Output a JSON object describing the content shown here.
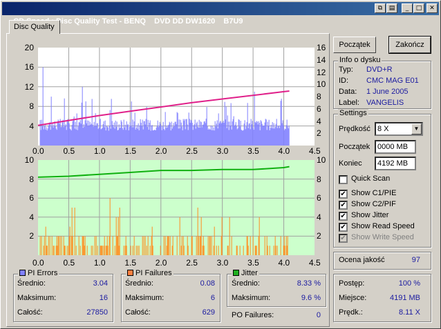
{
  "window": {
    "title": "CD Speed : Disc Quality Test - BENQ    DVD DD DW1620    B7U9",
    "buttons": {
      "restore": "⧉",
      "minimize": "_",
      "maximize": "□",
      "close": "✕"
    }
  },
  "tab": {
    "label": "Disc Quality"
  },
  "charts": {
    "top": {
      "y_left_ticks": [
        "20",
        "16",
        "12",
        "8",
        "4"
      ],
      "y_right_ticks": [
        "16",
        "14",
        "12",
        "10",
        "8",
        "6",
        "4",
        "2"
      ],
      "x_ticks": [
        "0.0",
        "0.5",
        "1.0",
        "1.5",
        "2.0",
        "2.5",
        "3.0",
        "3.5",
        "4.0",
        "4.5"
      ]
    },
    "bottom": {
      "y_left_ticks": [
        "10",
        "8",
        "6",
        "4",
        "2"
      ],
      "y_right_ticks": [
        "10",
        "8",
        "6",
        "4",
        "2"
      ],
      "x_ticks": [
        "0.0",
        "0.5",
        "1.0",
        "1.5",
        "2.0",
        "2.5",
        "3.0",
        "3.5",
        "4.0",
        "4.5"
      ]
    }
  },
  "chart_data": [
    {
      "type": "bar",
      "xlim": [
        0,
        4.5
      ],
      "ylim": [
        0,
        20
      ],
      "y2lim": [
        0,
        16
      ],
      "grid": true,
      "series": [
        {
          "name": "PI Errors",
          "color": "#8080ff",
          "approx_baseline": 3,
          "max": 16
        },
        {
          "name": "Read Speed",
          "color": "#e0208a",
          "type": "line",
          "x": [
            0.0,
            0.5,
            1.0,
            1.5,
            2.0,
            2.5,
            3.0,
            3.5,
            4.0,
            4.09
          ],
          "values": [
            3.3,
            4.1,
            4.9,
            5.6,
            6.3,
            7.0,
            7.6,
            8.2,
            8.8,
            8.9
          ]
        }
      ]
    },
    {
      "type": "bar",
      "xlim": [
        0,
        4.5
      ],
      "ylim": [
        0,
        10
      ],
      "grid": true,
      "series": [
        {
          "name": "PI Failures",
          "color": "#ff8c20",
          "max": 6
        },
        {
          "name": "Jitter",
          "color": "#10b010",
          "type": "line",
          "x": [
            0.0,
            0.5,
            1.0,
            1.5,
            2.0,
            2.5,
            3.0,
            3.5,
            4.0,
            4.09
          ],
          "values": [
            8.2,
            8.3,
            8.5,
            8.7,
            8.9,
            8.9,
            9.0,
            9.0,
            9.2,
            9.3
          ]
        }
      ]
    }
  ],
  "stats": {
    "pi_errors": {
      "title": "PI Errors",
      "color": "#8080ff",
      "avg_label": "Średnio:",
      "avg": "3.04",
      "max_label": "Maksimum:",
      "max": "16",
      "total_label": "Całość:",
      "total": "27850"
    },
    "pi_failures": {
      "title": "PI Failures",
      "color": "#ff8040",
      "avg_label": "Średnio:",
      "avg": "0.08",
      "max_label": "Maksimum:",
      "max": "6",
      "total_label": "Całość:",
      "total": "629"
    },
    "jitter": {
      "title": "Jitter",
      "color": "#20b020",
      "avg_label": "Średnio:",
      "avg": "8.33 %",
      "max_label": "Maksimum:",
      "max": "9.6 %"
    },
    "po_failures": {
      "label": "PO Failures:",
      "value": "0"
    }
  },
  "buttons": {
    "start": "Początek",
    "end": "Zakończ"
  },
  "info": {
    "title": "Info o dysku",
    "type_label": "Typ:",
    "type": "DVD+R",
    "id_label": "ID:",
    "id": "CMC MAG E01",
    "date_label": "Data:",
    "date": "1 June 2005",
    "label_label": "Label:",
    "label": "VANGELIS"
  },
  "settings": {
    "title": "Settings",
    "speed_label": "Prędkość",
    "speed": "8 X",
    "start_label": "Początek",
    "start": "0000 MB",
    "end_label": "Koniec",
    "end": "4192 MB",
    "quick_scan": "Quick Scan",
    "show_c1": "Show C1/PIE",
    "show_c2": "Show C2/PIF",
    "show_jitter": "Show Jitter",
    "show_read": "Show Read Speed",
    "show_write": "Show Write Speed"
  },
  "quality": {
    "label": "Ocena jakość",
    "value": "97"
  },
  "progress": {
    "progress_label": "Postęp:",
    "progress": "100 %",
    "position_label": "Miejsce:",
    "position": "4191 MB",
    "speed_label": "Prędk.:",
    "speed": "8.11 X"
  }
}
